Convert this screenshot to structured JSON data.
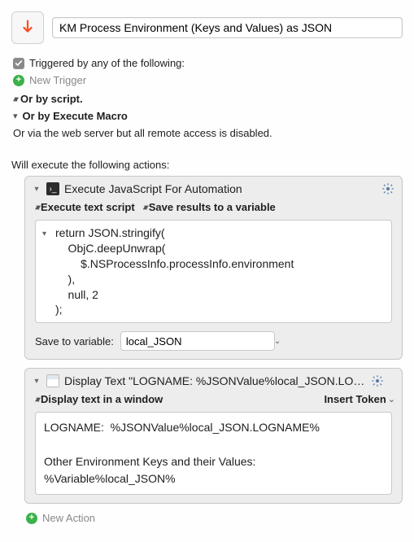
{
  "header": {
    "macro_name": "KM Process Environment (Keys and Values) as JSON"
  },
  "triggers": {
    "label": "Triggered by any of the following:",
    "new_trigger": "New Trigger",
    "by_script": "Or by script.",
    "by_execute_macro": "Or by Execute Macro",
    "via_web": "Or via the web server but all remote access is disabled."
  },
  "exec_label": "Will execute the following actions:",
  "action1": {
    "title": "Execute JavaScript For Automation",
    "sub_left": "Execute text script",
    "sub_right": "Save results to a variable",
    "code": "return JSON.stringify(\n    ObjC.deepUnwrap(\n        $.NSProcessInfo.processInfo.environment\n    ),\n    null, 2\n);",
    "save_label": "Save to variable:",
    "save_var": "local_JSON"
  },
  "action2": {
    "title": "Display Text \"LOGNAME:  %JSONValue%local_JSON.LOGNAM…",
    "sub_left": "Display text in a window",
    "sub_right": "Insert Token",
    "body": "LOGNAME:  %JSONValue%local_JSON.LOGNAME%\n\nOther Environment Keys and their Values:\n%Variable%local_JSON%"
  },
  "new_action": "New Action"
}
